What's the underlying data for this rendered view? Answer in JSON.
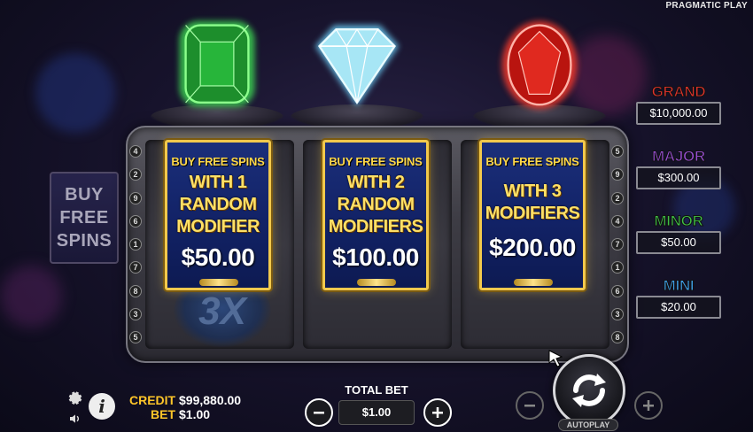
{
  "brand": "PRAGMATIC PLAY",
  "side_button": {
    "lines": [
      "BUY",
      "FREE",
      "SPINS"
    ]
  },
  "paylines_left": [
    "4",
    "2",
    "9",
    "6",
    "1",
    "7",
    "8",
    "3",
    "5"
  ],
  "paylines_right": [
    "5",
    "9",
    "2",
    "4",
    "7",
    "1",
    "6",
    "3",
    "8"
  ],
  "multiplier": "3X",
  "offers": [
    {
      "header": "BUY FREE SPINS",
      "lines": [
        "WITH 1",
        "RANDOM",
        "MODIFIER"
      ],
      "price": "$50.00"
    },
    {
      "header": "BUY FREE SPINS",
      "lines": [
        "WITH 2",
        "RANDOM",
        "MODIFIERS"
      ],
      "price": "$100.00"
    },
    {
      "header": "BUY FREE SPINS",
      "lines": [
        "WITH 3",
        "MODIFIERS"
      ],
      "price": "$200.00"
    }
  ],
  "jackpots": [
    {
      "label": "GRAND",
      "value": "$10,000.00",
      "color": "#e0322b"
    },
    {
      "label": "MAJOR",
      "value": "$300.00",
      "color": "#9b4fd8"
    },
    {
      "label": "MINOR",
      "value": "$50.00",
      "color": "#3fbf45"
    },
    {
      "label": "MINI",
      "value": "$20.00",
      "color": "#3fa0e8"
    }
  ],
  "balance": {
    "credit_label": "CREDIT",
    "credit_value": "$99,880.00",
    "bet_label": "BET",
    "bet_value": "$1.00"
  },
  "total_bet": {
    "label": "TOTAL BET",
    "value": "$1.00"
  },
  "autoplay_label": "AUTOPLAY",
  "colors": {
    "gold": "#f2c94c",
    "card_blue": "#122266",
    "credit_label": "#ffc629"
  }
}
